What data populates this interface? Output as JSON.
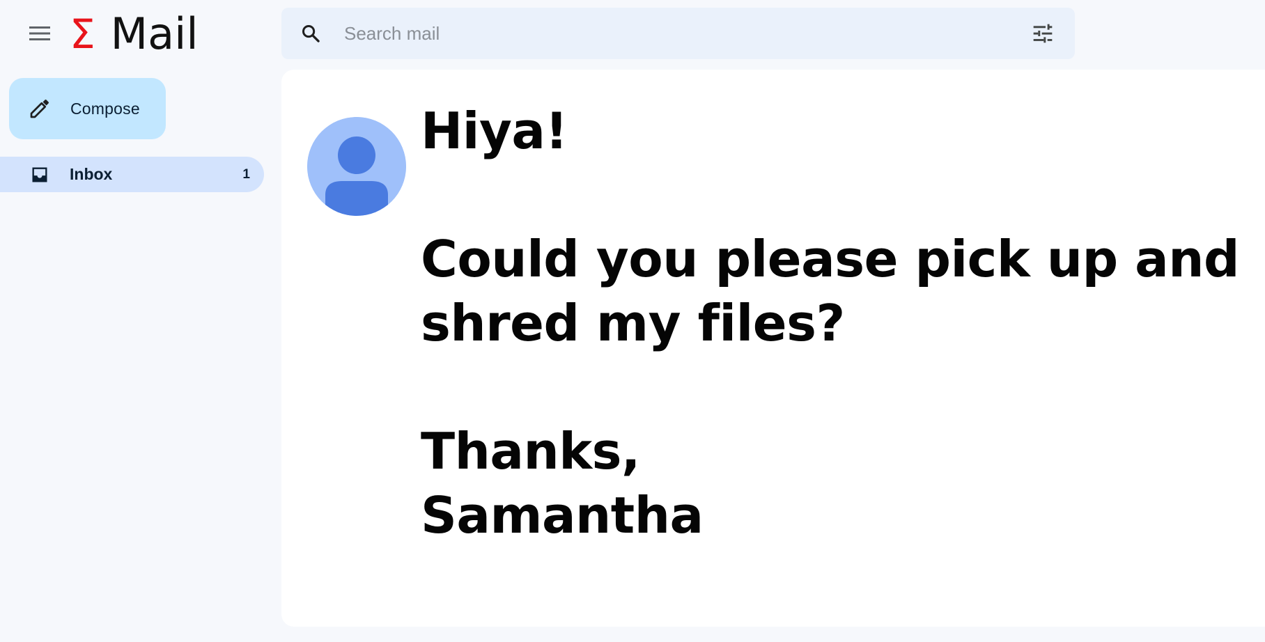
{
  "app": {
    "logo_symbol": "Σ",
    "logo_text": "Mail",
    "brand_color": "#e8141b"
  },
  "header": {
    "menu_icon": "hamburger-menu-icon",
    "search": {
      "placeholder": "Search mail",
      "value": "",
      "icon": "search-icon",
      "filter_icon": "tune-icon"
    }
  },
  "sidebar": {
    "compose_label": "Compose",
    "compose_icon": "pencil-icon",
    "items": [
      {
        "label": "Inbox",
        "count": "1",
        "icon": "inbox-icon",
        "selected": true
      }
    ]
  },
  "message": {
    "avatar_icon": "person-avatar-icon",
    "lines": [
      "Hiya!",
      "",
      "Could you please pick up and",
      "shred my files?",
      "",
      "Thanks,",
      "Samantha"
    ]
  },
  "colors": {
    "background": "#f6f8fc",
    "search_bg": "#eaf1fb",
    "compose_bg": "#c2e7ff",
    "inbox_selected_bg": "#d3e3fd",
    "avatar_bg": "#9fc0fa",
    "avatar_fg": "#4a7be0"
  }
}
